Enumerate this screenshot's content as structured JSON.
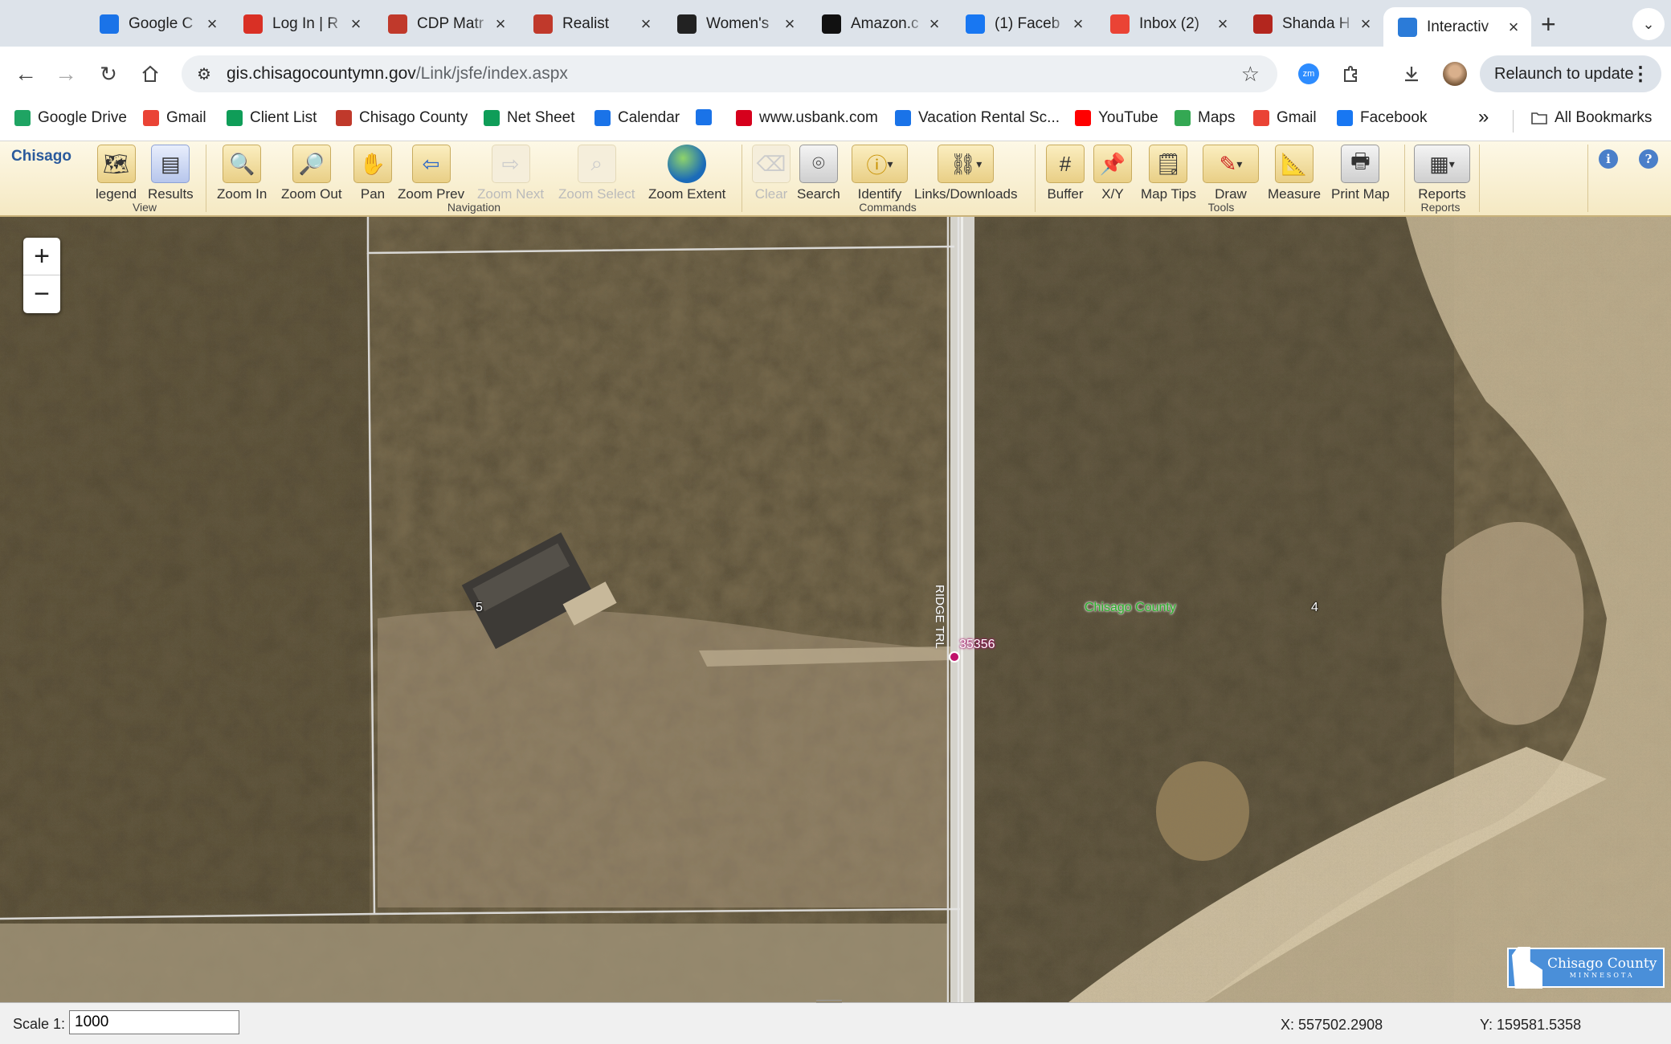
{
  "browser": {
    "tabs": [
      {
        "title": "Google C",
        "icon": "calendar-icon",
        "color": "#1a73e8"
      },
      {
        "title": "Log In | R",
        "icon": "target-icon",
        "color": "#d93025"
      },
      {
        "title": "CDP Matr",
        "icon": "cube-icon",
        "color": "#c0392b"
      },
      {
        "title": "Realist",
        "icon": "cube-icon",
        "color": "#c0392b"
      },
      {
        "title": "Women's",
        "icon": "store-icon",
        "color": "#222222"
      },
      {
        "title": "Amazon.c",
        "icon": "amazon-icon",
        "color": "#111111"
      },
      {
        "title": "(1) Faceb",
        "icon": "facebook-icon",
        "color": "#1877f2"
      },
      {
        "title": "Inbox (2)",
        "icon": "gmail-icon",
        "color": "#ea4335"
      },
      {
        "title": "Shanda H",
        "icon": "arch-icon",
        "color": "#b3261e"
      },
      {
        "title": "Interactiv",
        "icon": "p-icon",
        "color": "#2b7bd8"
      }
    ],
    "url_host": "gis.chisagocountymn.gov",
    "url_path": "/Link/jsfe/index.aspx",
    "relaunch_label": "Relaunch to update",
    "bookmarks": [
      {
        "label": "Google Drive",
        "icon": "drive-icon"
      },
      {
        "label": "Gmail",
        "icon": "gmail-icon"
      },
      {
        "label": "Client List",
        "icon": "sheets-icon"
      },
      {
        "label": "Chisago County",
        "icon": "chain-icon"
      },
      {
        "label": "Net Sheet",
        "icon": "sheets-icon"
      },
      {
        "label": "Calendar",
        "icon": "calendar-icon"
      },
      {
        "label": "",
        "icon": "diamond-icon"
      },
      {
        "label": "www.usbank.com",
        "icon": "usbank-icon"
      },
      {
        "label": "Vacation Rental Sc...",
        "icon": "check-icon"
      },
      {
        "label": "YouTube",
        "icon": "youtube-icon"
      },
      {
        "label": "Maps",
        "icon": "maps-icon"
      },
      {
        "label": "Gmail",
        "icon": "gmail-icon"
      },
      {
        "label": "Facebook",
        "icon": "facebook-icon"
      }
    ],
    "all_bookmarks": "All Bookmarks",
    "overflow": "»"
  },
  "gis": {
    "brand": "Chisago",
    "groups": {
      "view": "View",
      "navigation": "Navigation",
      "commands": "Commands",
      "tools": "Tools",
      "reports": "Reports"
    },
    "buttons": {
      "legend": "legend",
      "results": "Results",
      "zoom_in": "Zoom In",
      "zoom_out": "Zoom Out",
      "pan": "Pan",
      "zoom_prev": "Zoom Prev",
      "zoom_next": "Zoom Next",
      "zoom_select": "Zoom Select",
      "zoom_extent": "Zoom Extent",
      "clear": "Clear",
      "search": "Search",
      "identify": "Identify",
      "links": "Links/Downloads",
      "buffer": "Buffer",
      "xy": "X/Y",
      "map_tips": "Map Tips",
      "draw": "Draw",
      "measure": "Measure",
      "print_map": "Print Map",
      "reports": "Reports"
    },
    "map": {
      "zoom_plus": "+",
      "zoom_minus": "−",
      "county_label": "Chisago County",
      "address_label": "35356",
      "road_label": "RIDGE TRL",
      "lot_label_1": "5",
      "lot_label_2": "4",
      "logo_text": "Chisago County",
      "logo_sub": "MINNESOTA"
    },
    "status": {
      "scale_label": "Scale 1:",
      "scale_value": "1000",
      "x_coord": "X: 557502.2908",
      "y_coord": "Y: 159581.5358"
    }
  }
}
